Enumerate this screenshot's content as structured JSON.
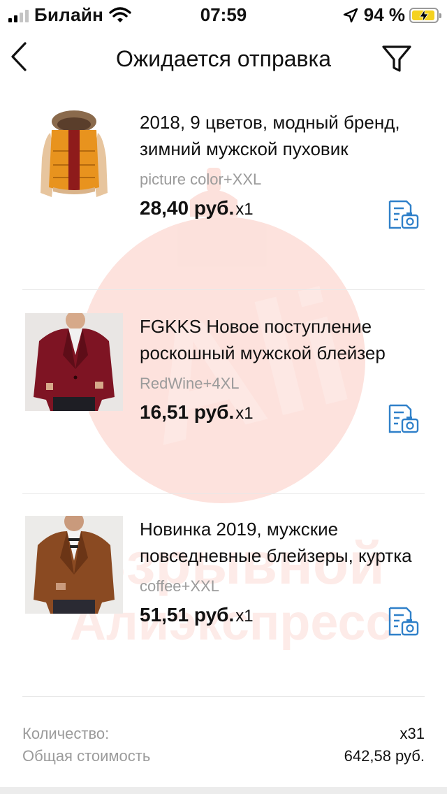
{
  "status_bar": {
    "carrier": "Билайн",
    "time": "07:59",
    "battery_percent": "94 %",
    "battery_level": 0.94,
    "battery_color": "#f5d21f"
  },
  "nav": {
    "back_icon": "chevron-left-icon",
    "title": "Ожидается отправка",
    "filter_icon": "filter-icon"
  },
  "items": [
    {
      "title": "2018, 9 цветов, модный бренд, зимний мужской пуховик",
      "variant": "picture color+XXL",
      "price": "28,40 руб.",
      "qty": "x1"
    },
    {
      "title": "FGKKS Новое поступление роскошный мужской блейзер",
      "variant": "RedWine+4XL",
      "price": "16,51 руб.",
      "qty": "x1"
    },
    {
      "title": "Новинка 2019, мужские повседневные блейзеры, куртка",
      "variant": "coffee+XXL",
      "price": "51,51 руб.",
      "qty": "x1"
    }
  ],
  "summary": {
    "quantity_label": "Количество:",
    "quantity_value": "x31",
    "total_label": "Общая стоимость",
    "total_value": "642,58 руб."
  },
  "watermark": {
    "logo_text": "Ali",
    "line1": "Взрывной",
    "line2": "Алиэкспресс",
    "color": "#f04a2e"
  }
}
